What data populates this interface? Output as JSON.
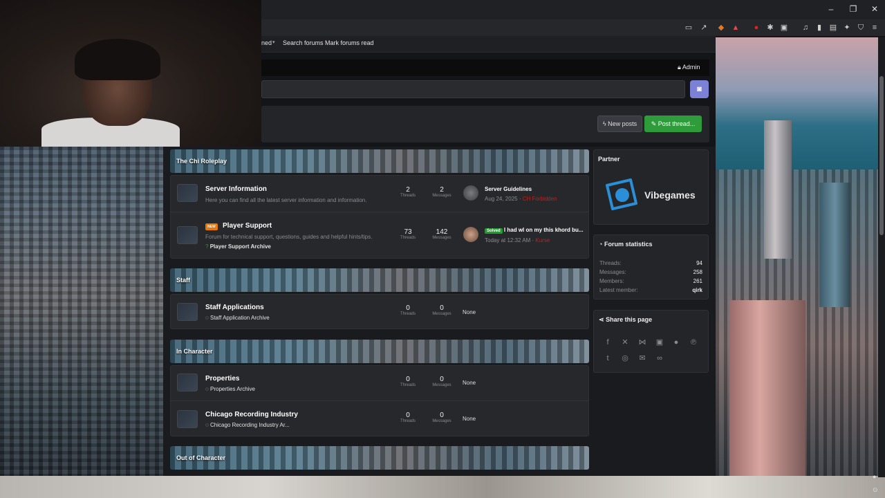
{
  "browser": {
    "nav_links": [
      "ned",
      "Search forums",
      "Mark forums read"
    ]
  },
  "admin_label": "Admin",
  "buttons": {
    "new_posts": "New posts",
    "post_thread": "Post thread..."
  },
  "categories": [
    {
      "title": "The Chi Roleplay"
    },
    {
      "title": "Staff"
    },
    {
      "title": "In Character"
    },
    {
      "title": "Out of Character"
    }
  ],
  "forums": {
    "server_info": {
      "title": "Server Information",
      "desc": "Here you can find all the latest server information and information.",
      "threads": "2",
      "messages": "2",
      "threads_label": "Threads",
      "messages_label": "Messages",
      "lp_title": "Server Guidelines",
      "lp_date": "Aug 24, 2025",
      "lp_user": "CH Forbidden"
    },
    "player_support": {
      "badge": "NEW",
      "title": "Player Support",
      "desc": "Forum for technical support, questions, guides and helpful hints/tips.",
      "sub": "Player Support Archive",
      "threads": "73",
      "messages": "142",
      "threads_label": "Threads",
      "messages_label": "Messages",
      "lp_badge": "Solved",
      "lp_title": "I had wl on my this khord bu...",
      "lp_date": "Today at 12:32 AM",
      "lp_user": "Kurse"
    },
    "staff_apps": {
      "title": "Staff Applications",
      "sub": "Staff Application Archive",
      "threads": "0",
      "messages": "0",
      "threads_label": "Threads",
      "messages_label": "Messages",
      "none": "None"
    },
    "properties": {
      "title": "Properties",
      "sub": "Properties Archive",
      "threads": "0",
      "messages": "0",
      "threads_label": "Threads",
      "messages_label": "Messages",
      "none": "None"
    },
    "recording": {
      "title": "Chicago Recording Industry",
      "sub": "Chicago Recording Industry Ar...",
      "threads": "0",
      "messages": "0",
      "threads_label": "Threads",
      "messages_label": "Messages",
      "none": "None"
    }
  },
  "sidebar": {
    "partner_title": "Partner",
    "partner_name": "Vibegames",
    "stats_title": "Forum statistics",
    "stats": [
      {
        "k": "Threads:",
        "v": "94"
      },
      {
        "k": "Messages:",
        "v": "258"
      },
      {
        "k": "Members:",
        "v": "261"
      },
      {
        "k": "Latest member:",
        "v": "qirk"
      }
    ],
    "share_title": "Share this page"
  },
  "colors": {
    "accent_green": "#2f9c3c",
    "discord": "#7b82d6",
    "new_badge": "#e6780a",
    "solved": "#1f9c2f"
  }
}
